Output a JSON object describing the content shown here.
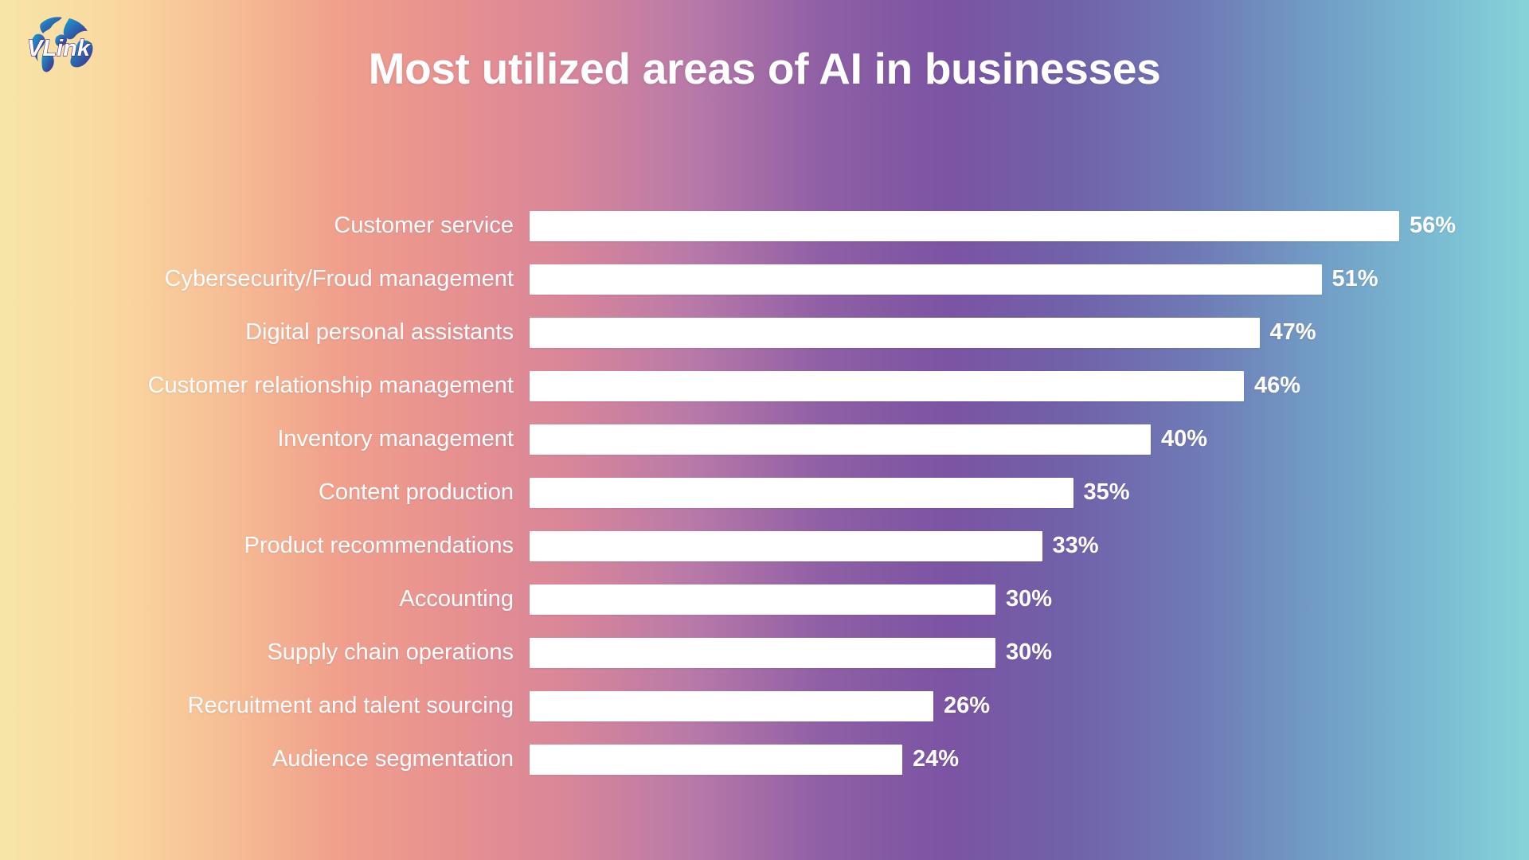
{
  "brand": {
    "logo_name": "vlink-globe-logo",
    "logo_text": "VLink",
    "logo_colors": {
      "globe_teal": "#1f9dd9",
      "globe_purple": "#4a2a83",
      "text": "#ffffff"
    }
  },
  "header": {
    "title": "Most utilized areas of AI in businesses"
  },
  "theme": {
    "bar_color": "#ffffff",
    "label_color": "#ffffff",
    "background_gradient": [
      "#f7e5a8",
      "#f0a08c",
      "#8e5fa5",
      "#7161a9",
      "#72a0c7",
      "#86d3d8"
    ]
  },
  "chart_data": {
    "type": "bar",
    "orientation": "horizontal",
    "title": "Most utilized areas of AI in businesses",
    "xlabel": "",
    "ylabel": "",
    "xlim": [
      0,
      56
    ],
    "grid": false,
    "legend": "none",
    "value_suffix": "%",
    "categories": [
      "Customer service",
      "Cybersecurity/Froud management",
      "Digital personal assistants",
      "Customer relationship management",
      "Inventory management",
      "Content production",
      "Product recommendations",
      "Accounting",
      "Supply chain operations",
      "Recruitment and talent sourcing",
      "Audience segmentation"
    ],
    "values": [
      56,
      51,
      47,
      46,
      40,
      35,
      33,
      30,
      30,
      26,
      24
    ],
    "labels": [
      "56%",
      "51%",
      "47%",
      "46%",
      "40%",
      "35%",
      "33%",
      "30%",
      "30%",
      "26%",
      "24%"
    ]
  }
}
